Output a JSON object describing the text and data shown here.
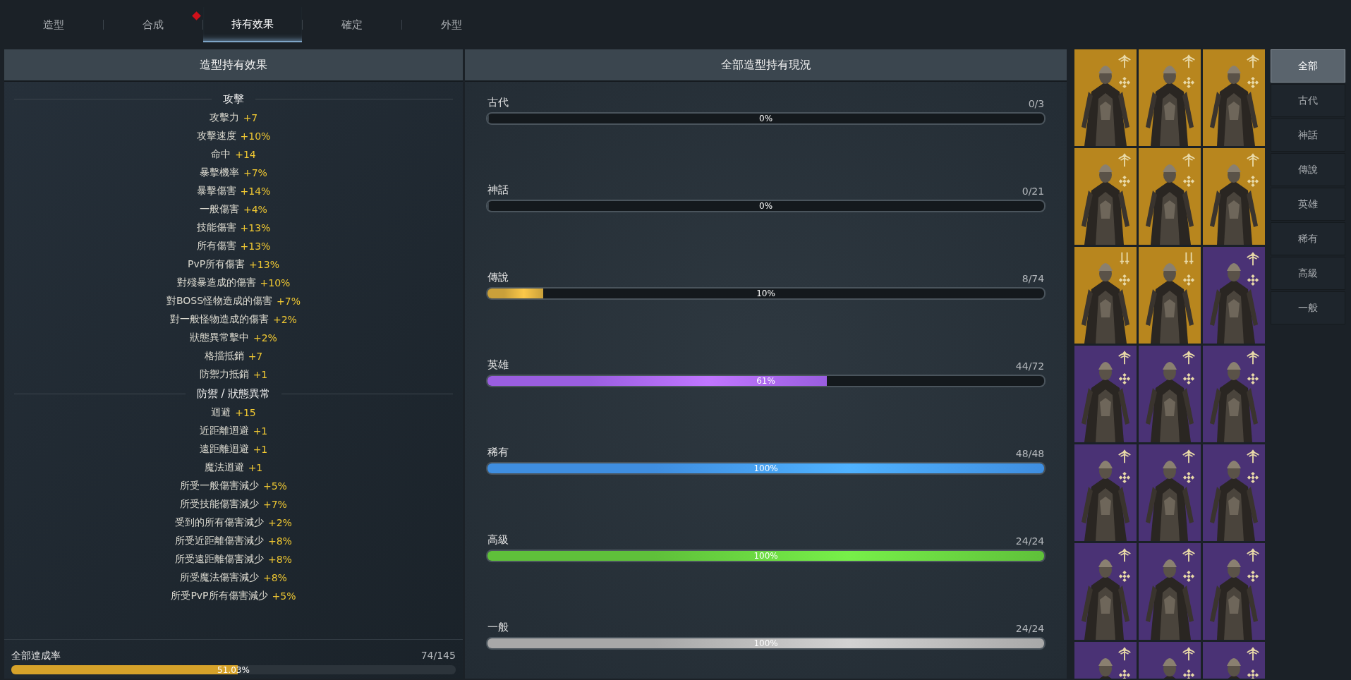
{
  "tabs": [
    {
      "label": "造型",
      "selected": false,
      "alert": false
    },
    {
      "label": "合成",
      "selected": false,
      "alert": true
    },
    {
      "label": "持有效果",
      "selected": true,
      "alert": false
    },
    {
      "label": "確定",
      "selected": false,
      "alert": false
    },
    {
      "label": "外型",
      "selected": false,
      "alert": false
    }
  ],
  "effects_panel": {
    "title": "造型持有效果",
    "sections": [
      {
        "title": "攻擊",
        "stats": [
          {
            "name": "攻擊力",
            "value": "+7"
          },
          {
            "name": "攻擊速度",
            "value": "+10%"
          },
          {
            "name": "命中",
            "value": "+14"
          },
          {
            "name": "暴擊機率",
            "value": "+7%"
          },
          {
            "name": "暴擊傷害",
            "value": "+14%"
          },
          {
            "name": "一般傷害",
            "value": "+4%"
          },
          {
            "name": "技能傷害",
            "value": "+13%"
          },
          {
            "name": "所有傷害",
            "value": "+13%"
          },
          {
            "name": "PvP所有傷害",
            "value": "+13%"
          },
          {
            "name": "對殘暴造成的傷害",
            "value": "+10%"
          },
          {
            "name": "對BOSS怪物造成的傷害",
            "value": "+7%"
          },
          {
            "name": "對一般怪物造成的傷害",
            "value": "+2%"
          },
          {
            "name": "狀態異常擊中",
            "value": "+2%"
          },
          {
            "name": "格擋抵銷",
            "value": "+7"
          },
          {
            "name": "防禦力抵銷",
            "value": "+1"
          }
        ]
      },
      {
        "title": "防禦 / 狀態異常",
        "stats": [
          {
            "name": "迴避",
            "value": "+15"
          },
          {
            "name": "近距離迴避",
            "value": "+1"
          },
          {
            "name": "遠距離迴避",
            "value": "+1"
          },
          {
            "name": "魔法迴避",
            "value": "+1"
          },
          {
            "name": "所受一般傷害減少",
            "value": "+5%"
          },
          {
            "name": "所受技能傷害減少",
            "value": "+7%"
          },
          {
            "name": "受到的所有傷害減少",
            "value": "+2%"
          },
          {
            "name": "所受近距離傷害減少",
            "value": "+8%"
          },
          {
            "name": "所受遠距離傷害減少",
            "value": "+8%"
          },
          {
            "name": "所受魔法傷害減少",
            "value": "+8%"
          },
          {
            "name": "所受PvP所有傷害減少",
            "value": "+5%"
          }
        ]
      }
    ],
    "total": {
      "label": "全部達成率",
      "count": "74/145",
      "level": 0.5103,
      "percent": "51.03%"
    }
  },
  "status_panel": {
    "title": "全部造型持有現況",
    "tiers": [
      {
        "name": "古代",
        "count": "0/3",
        "level": 0,
        "percent": "0%"
      },
      {
        "name": "神話",
        "count": "0/21",
        "level": 0,
        "percent": "0%"
      },
      {
        "name": "傳說",
        "count": "8/74",
        "level": 0.1,
        "percent": "10%",
        "color": "#c9a03a"
      },
      {
        "name": "英雄",
        "count": "44/72",
        "level": 0.61,
        "percent": "61%",
        "color": "#9a5ee0"
      },
      {
        "name": "稀有",
        "count": "48/48",
        "level": 1,
        "percent": "100%",
        "color": "#3f8ee0"
      },
      {
        "name": "高級",
        "count": "24/24",
        "level": 1,
        "percent": "100%",
        "color": "#5fc03a"
      },
      {
        "name": "一般",
        "count": "24/24",
        "level": 1,
        "percent": "100%",
        "color": "#a8a8a8"
      }
    ]
  },
  "cards": [
    {
      "color": "#b8861e",
      "kind": "bow"
    },
    {
      "color": "#b8861e",
      "kind": "bow"
    },
    {
      "color": "#b8861e",
      "kind": "bow"
    },
    {
      "color": "#b8861e",
      "kind": "bow"
    },
    {
      "color": "#b8861e",
      "kind": "bow"
    },
    {
      "color": "#b8861e",
      "kind": "bow"
    },
    {
      "color": "#b8861e",
      "kind": "swords"
    },
    {
      "color": "#b8861e",
      "kind": "swords"
    },
    {
      "color": "#4a3275",
      "kind": "bow"
    },
    {
      "color": "#4a3275",
      "kind": "bow"
    },
    {
      "color": "#4a3275",
      "kind": "bow"
    },
    {
      "color": "#4a3275",
      "kind": "bow"
    },
    {
      "color": "#4a3275",
      "kind": "bow"
    },
    {
      "color": "#4a3275",
      "kind": "bow"
    },
    {
      "color": "#4a3275",
      "kind": "bow"
    },
    {
      "color": "#4a3275",
      "kind": "bow"
    },
    {
      "color": "#4a3275",
      "kind": "bow"
    },
    {
      "color": "#4a3275",
      "kind": "bow"
    },
    {
      "color": "#4a3275",
      "kind": "bow"
    },
    {
      "color": "#4a3275",
      "kind": "bow"
    },
    {
      "color": "#4a3275",
      "kind": "bow"
    }
  ],
  "filters": [
    {
      "label": "全部",
      "selected": true
    },
    {
      "label": "古代",
      "selected": false
    },
    {
      "label": "神話",
      "selected": false
    },
    {
      "label": "傳說",
      "selected": false
    },
    {
      "label": "英雄",
      "selected": false
    },
    {
      "label": "稀有",
      "selected": false
    },
    {
      "label": "高級",
      "selected": false
    },
    {
      "label": "一般",
      "selected": false
    }
  ]
}
